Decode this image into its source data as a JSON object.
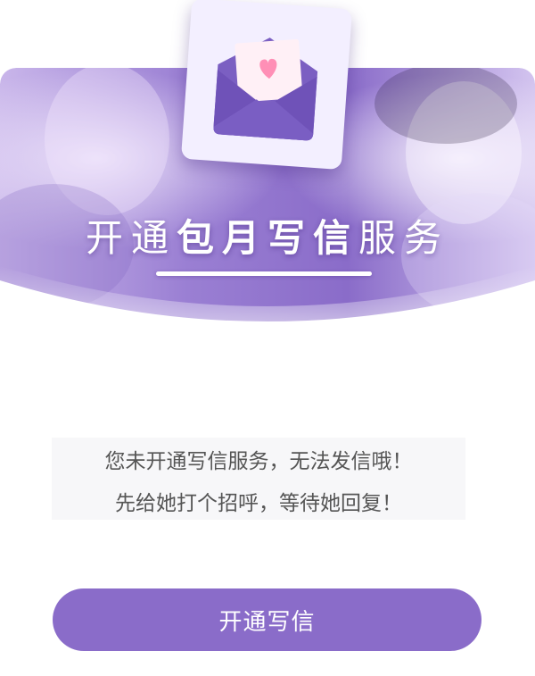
{
  "header": {
    "title_light_prefix": "开通",
    "title_bold": "包月写信",
    "title_light_suffix": "服务"
  },
  "message": {
    "line1": "您未开通写信服务，无法发信哦！",
    "line2": "先给她打个招呼，等待她回复！"
  },
  "button": {
    "label": "开通写信"
  },
  "colors": {
    "accent": "#8a6cc9",
    "header_purple": "#8e72c9",
    "envelope": "#7b5fc2",
    "heart": "#ff8fb6",
    "card": "#f3efff"
  },
  "icons": {
    "envelope": "envelope-heart-icon"
  }
}
